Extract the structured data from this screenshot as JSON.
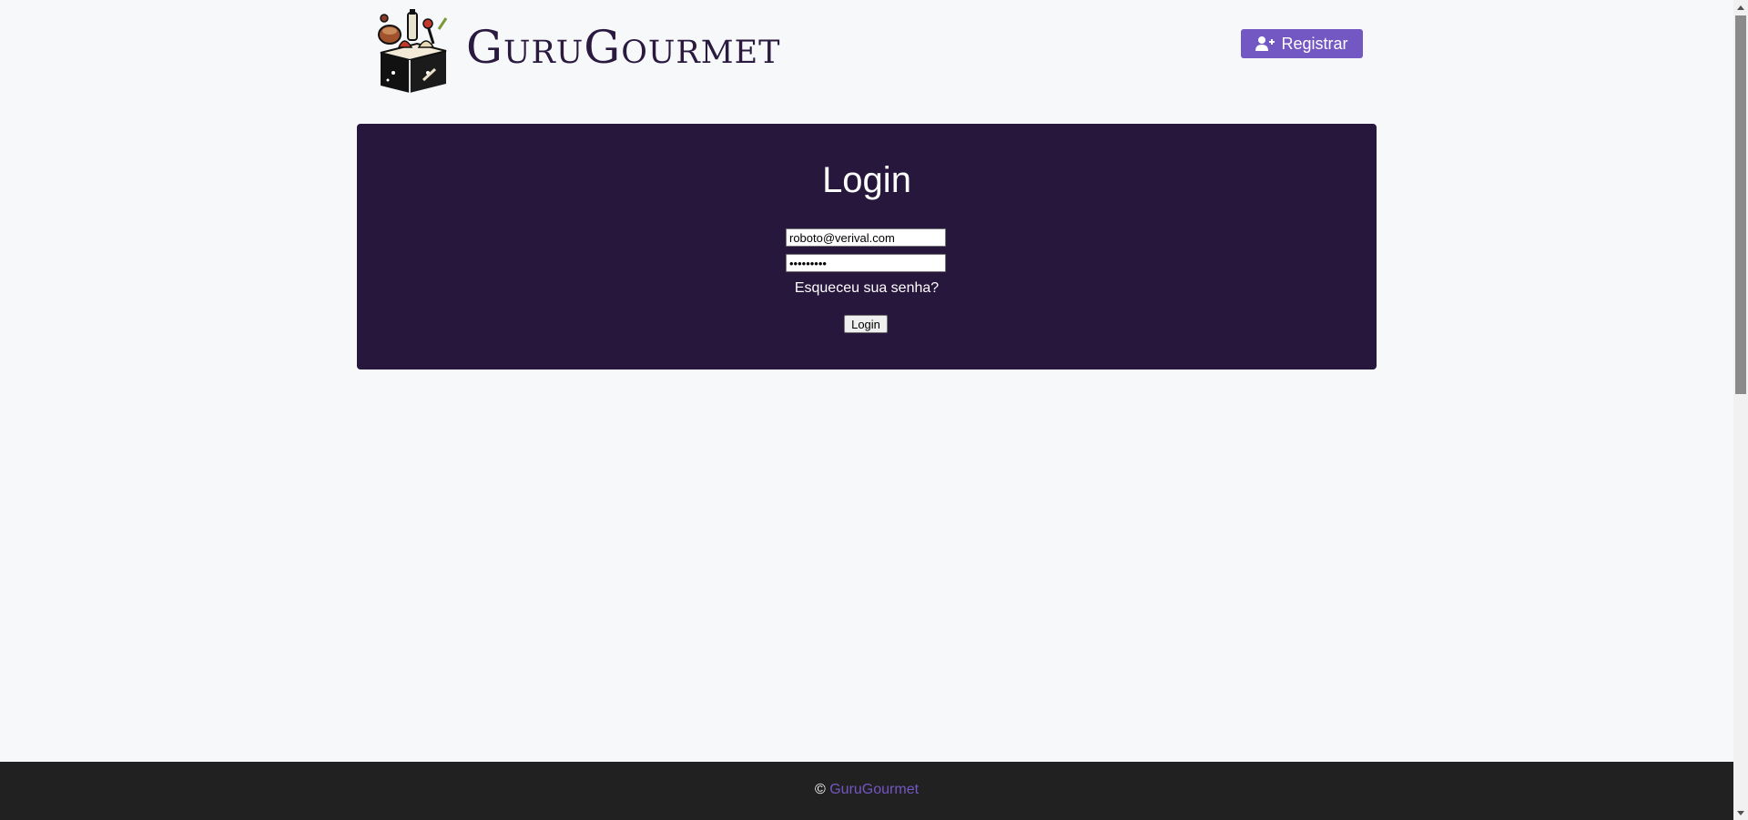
{
  "header": {
    "brand": "GuruGourmet",
    "logo_icon": "cookbook-logo-icon",
    "register_label": "Registrar",
    "register_icon": "user-plus-icon"
  },
  "login": {
    "title": "Login",
    "email_value": "roboto@verival.com",
    "password_value": "•••••••••",
    "forgot_label": "Esqueceu sua senha?",
    "submit_label": "Login"
  },
  "footer": {
    "copyright_symbol": "©",
    "link_label": "GuruGourmet"
  },
  "colors": {
    "accent": "#7357c2",
    "card_bg": "#27173d",
    "footer_bg": "#212121",
    "page_bg": "#f7f8fa"
  }
}
